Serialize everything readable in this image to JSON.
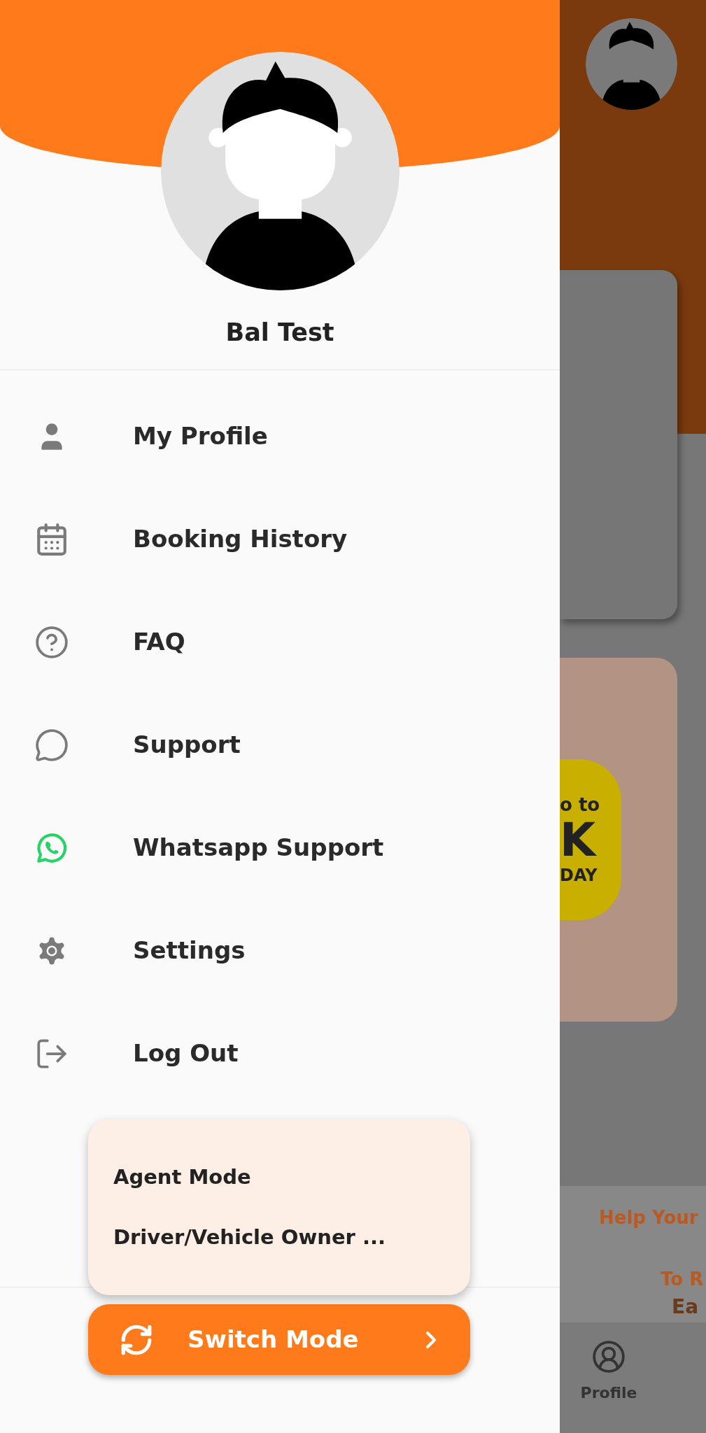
{
  "drawer": {
    "user_name": "Bal Test",
    "menu": [
      {
        "kind": "profile",
        "label": "My Profile"
      },
      {
        "kind": "calendar",
        "label": "Booking History"
      },
      {
        "kind": "faq",
        "label": "FAQ"
      },
      {
        "kind": "chat",
        "label": "Support"
      },
      {
        "kind": "whatsapp",
        "label": "Whatsapp Support"
      },
      {
        "kind": "settings",
        "label": "Settings"
      },
      {
        "kind": "logout",
        "label": "Log Out"
      }
    ],
    "mode_menu": [
      "Agent Mode",
      "Driver/Vehicle Owner ..."
    ],
    "switch_button": "Switch Mode"
  },
  "background": {
    "promo_texts": [
      "o to",
      "K",
      "DAY"
    ],
    "banner_texts": [
      "Help Your",
      "To R",
      "Ea"
    ],
    "bottom_nav": [
      {
        "label": "Profile"
      }
    ]
  }
}
